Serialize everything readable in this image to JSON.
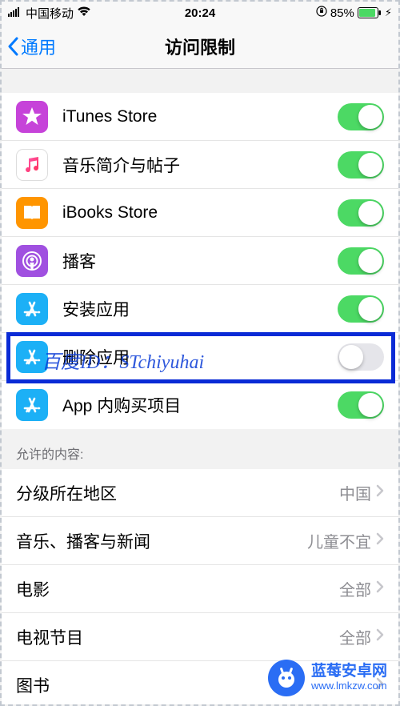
{
  "status": {
    "carrier": "中国移动",
    "time": "20:24",
    "battery_pct": "85%"
  },
  "nav": {
    "back_label": "通用",
    "title": "访问限制"
  },
  "toggles": [
    {
      "label": "iTunes Store",
      "on": true,
      "icon": "itunes",
      "icon_bg": "#c643d9"
    },
    {
      "label": "音乐简介与帖子",
      "on": true,
      "icon": "music",
      "icon_bg": "#ffffff"
    },
    {
      "label": "iBooks Store",
      "on": true,
      "icon": "ibooks",
      "icon_bg": "#ff9500"
    },
    {
      "label": "播客",
      "on": true,
      "icon": "podcasts",
      "icon_bg": "#a050e0"
    },
    {
      "label": "安装应用",
      "on": true,
      "icon": "appstore",
      "icon_bg": "#1cb0f6"
    },
    {
      "label": "删除应用",
      "on": false,
      "icon": "appstore",
      "icon_bg": "#1cb0f6",
      "highlighted": true
    },
    {
      "label": "App 内购买项目",
      "on": true,
      "icon": "appstore",
      "icon_bg": "#1cb0f6"
    }
  ],
  "content_section": {
    "header": "允许的内容:",
    "rows": [
      {
        "label": "分级所在地区",
        "value": "中国"
      },
      {
        "label": "音乐、播客与新闻",
        "value": "儿童不宜"
      },
      {
        "label": "电影",
        "value": "全部"
      },
      {
        "label": "电视节目",
        "value": "全部"
      },
      {
        "label": "图书",
        "value": ""
      }
    ]
  },
  "watermark": "百度ID：STchiyuhai",
  "brand": {
    "name": "蓝莓安卓网",
    "url": "www.lmkzw.com"
  }
}
